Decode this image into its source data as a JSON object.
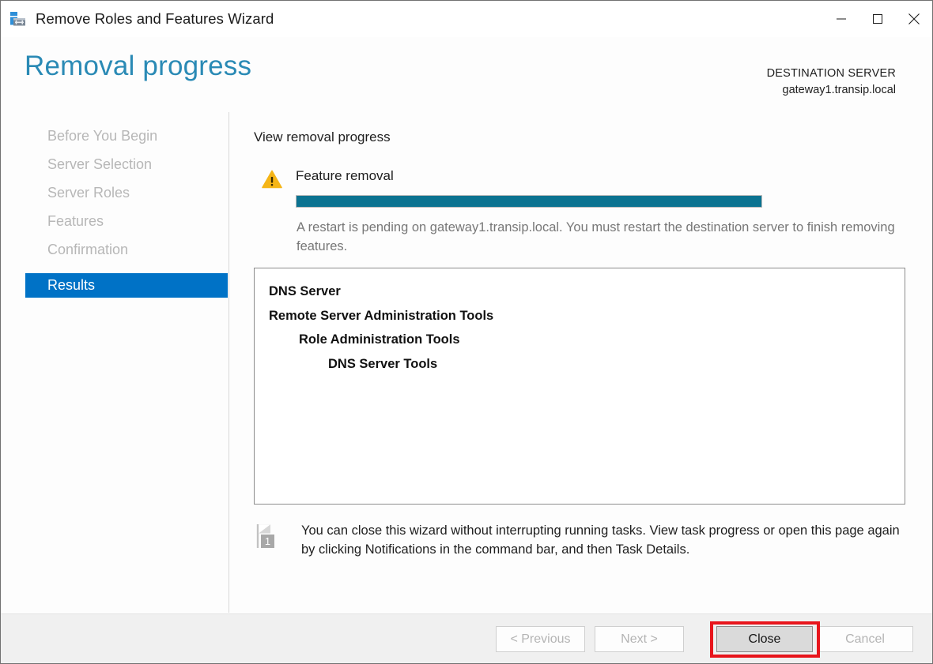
{
  "window": {
    "title": "Remove Roles and Features Wizard",
    "icon": "server-roles-icon",
    "controls": {
      "minimize": "minimize-icon",
      "maximize": "maximize-icon",
      "close": "close-icon"
    }
  },
  "header": {
    "page_title": "Removal progress",
    "destination_label": "DESTINATION SERVER",
    "destination_server": "gateway1.transip.local",
    "title_color": "#2a8ab5"
  },
  "sidebar": {
    "items": [
      {
        "label": "Before You Begin",
        "selected": false
      },
      {
        "label": "Server Selection",
        "selected": false
      },
      {
        "label": "Server Roles",
        "selected": false
      },
      {
        "label": "Features",
        "selected": false
      },
      {
        "label": "Confirmation",
        "selected": false
      },
      {
        "label": "Results",
        "selected": true
      }
    ],
    "selected_color": "#0072c6",
    "disabled_color": "#b7b7b7"
  },
  "main": {
    "section_heading": "View removal progress",
    "status_icon": "warning-triangle-icon",
    "status_label": "Feature removal",
    "progress": {
      "percent": 100,
      "fill_color": "#0b7391",
      "track_color": "#e9e9e9"
    },
    "status_message": "A restart is pending on gateway1.transip.local. You must restart the destination server to finish removing features.",
    "result_items": [
      {
        "label": "DNS Server",
        "level": 0
      },
      {
        "label": "Remote Server Administration Tools",
        "level": 1
      },
      {
        "label": "Role Administration Tools",
        "level": 2
      },
      {
        "label": "DNS Server Tools",
        "level": 3
      }
    ],
    "note_icon": "notification-flag-icon",
    "note_badge": "1",
    "note_text": "You can close this wizard without interrupting running tasks. View task progress or open this page again by clicking Notifications in the command bar, and then Task Details."
  },
  "footer": {
    "buttons": [
      {
        "label": "< Previous",
        "enabled": false
      },
      {
        "label": "Next >",
        "enabled": false
      },
      {
        "label": "Close",
        "enabled": true
      },
      {
        "label": "Cancel",
        "enabled": false
      }
    ],
    "highlight_color": "#e8151c"
  }
}
